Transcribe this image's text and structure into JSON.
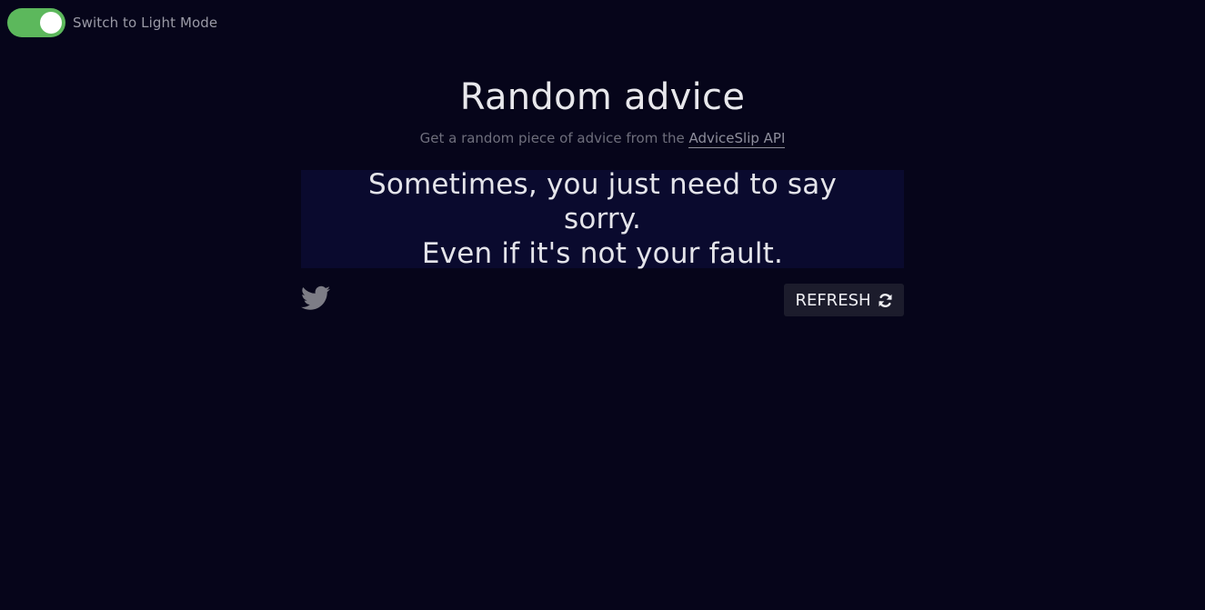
{
  "theme_toggle": {
    "label": "Switch to Light Mode",
    "state": "on",
    "track_color": "#5cb85c"
  },
  "header": {
    "title": "Random advice",
    "subtitle_prefix": "Get a random piece of advice from the ",
    "subtitle_link": "AdviceSlip API"
  },
  "advice": {
    "line1": "Sometimes, you just need to say sorry.",
    "line2": "Even if it's not your fault."
  },
  "actions": {
    "tweet_icon": "twitter-icon",
    "refresh_label": "REFRESH",
    "refresh_icon": "refresh-icon"
  },
  "colors": {
    "background": "#06051a",
    "card": "#0a0a2e",
    "button": "#1c1c2c"
  }
}
